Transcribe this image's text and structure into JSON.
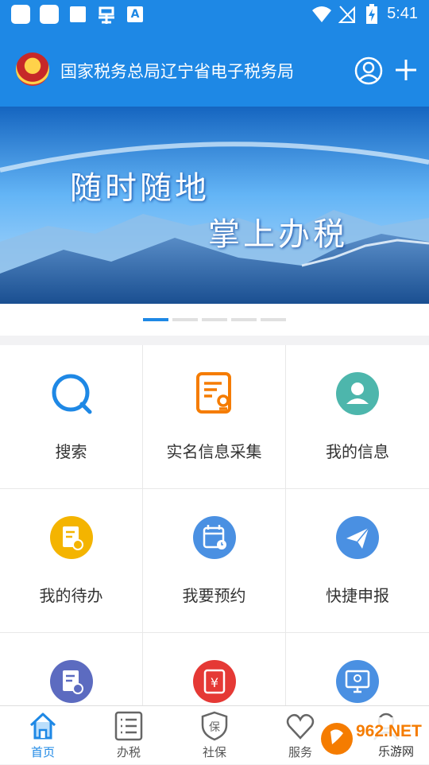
{
  "status_bar": {
    "time": "5:41",
    "app_icon_text": "A"
  },
  "header": {
    "title": "国家税务总局辽宁省电子税务局",
    "icons": [
      "tax-emblem-icon",
      "user-icon",
      "plus-icon"
    ]
  },
  "banner": {
    "line1": "随时随地",
    "line2": "掌上办税",
    "slide_count": 5,
    "active_slide": 1
  },
  "grid": {
    "items": [
      {
        "label": "搜索",
        "icon": "search-icon",
        "color": "#1e88e5"
      },
      {
        "label": "实名信息采集",
        "icon": "id-card-icon",
        "color": "#f57c00"
      },
      {
        "label": "我的信息",
        "icon": "user-icon",
        "color": "#4db6ac"
      },
      {
        "label": "我的待办",
        "icon": "todo-icon",
        "color": "#f4b400"
      },
      {
        "label": "我要预约",
        "icon": "calendar-icon",
        "color": "#4a90e2"
      },
      {
        "label": "快捷申报",
        "icon": "send-icon",
        "color": "#4a90e2"
      },
      {
        "label": "",
        "icon": "document-edit-icon",
        "color": "#5c6bc0"
      },
      {
        "label": "",
        "icon": "yen-ticket-icon",
        "color": "#e53935"
      },
      {
        "label": "",
        "icon": "monitor-search-icon",
        "color": "#4a90e2"
      }
    ]
  },
  "tabbar": {
    "tabs": [
      {
        "label": "首页",
        "icon": "home-icon",
        "active": true
      },
      {
        "label": "办税",
        "icon": "list-icon",
        "active": false
      },
      {
        "label": "社保",
        "icon": "shield-icon",
        "active": false
      },
      {
        "label": "服务",
        "icon": "heart-icon",
        "active": false
      },
      {
        "label": "",
        "icon": "user-icon",
        "active": false
      }
    ]
  },
  "watermark": {
    "brand": "962.NET",
    "sub": "乐游网"
  },
  "colors": {
    "primary": "#1e88e5",
    "active_tab": "#1e88e5"
  }
}
